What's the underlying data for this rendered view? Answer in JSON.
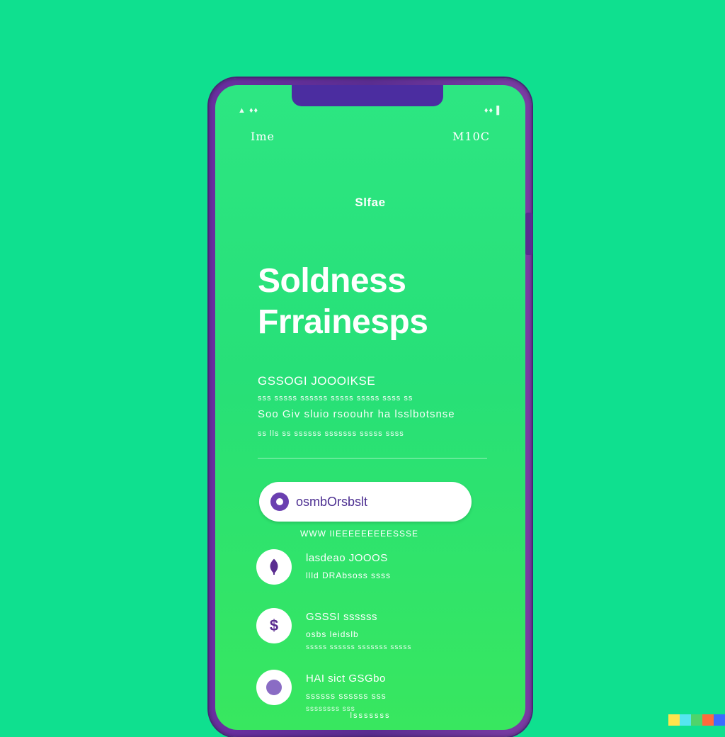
{
  "status_bar": {
    "left": "▲ ♦♦",
    "right": "♦♦ ▌"
  },
  "header": {
    "left_label": "Ime",
    "right_label": "M10C"
  },
  "brand": "Slfae",
  "hero": {
    "line1": "Soldness",
    "line2": "Frrainesps"
  },
  "description": {
    "heading": "GSSOGI JOOOIKSE",
    "line1": "sss sssss ssssss sssss sssss ssss ss",
    "line2": "Soo Giv sluio rsoouhr ha lsslbotsnse",
    "line3": "ss lls ss ssssss sssssss sssss ssss"
  },
  "search": {
    "placeholder": "osmbOrsbslt",
    "hint": "WWW IIEEEEEEEEESSSE"
  },
  "items": [
    {
      "title": "lasdeao JOOOS",
      "sub": "llld DRAbsoss ssss",
      "meta": ""
    },
    {
      "title": "GSSSI ssssss",
      "sub": "osbs leidslb",
      "meta": "sssss ssssss sssssss sssss"
    },
    {
      "title": "HAI sict GSGbo",
      "sub": "ssssss ssssss sss",
      "meta": "ssssssss sss"
    }
  ],
  "footer_text": "lsssssss",
  "colors": {
    "background": "#0fe08f",
    "screen": "#2de682",
    "phone_frame": "#6a2fa0",
    "accent": "#4b2d90"
  },
  "icons": [
    "search-icon",
    "leaf-icon",
    "dollar-icon",
    "circle-icon"
  ]
}
